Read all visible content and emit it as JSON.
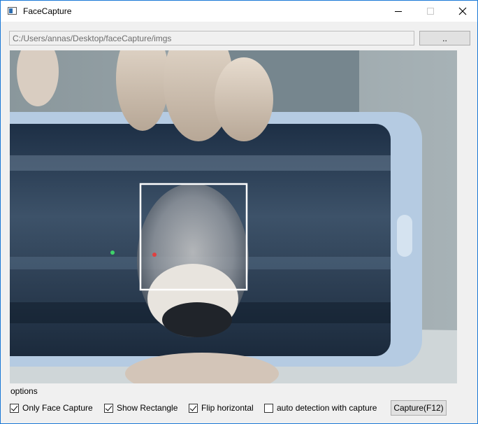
{
  "window": {
    "title": "FaceCapture",
    "accent": "#1a78d6"
  },
  "path": {
    "value": "C:/Users/annas/Desktop/faceCapture/imgs",
    "browse_label": ".."
  },
  "preview": {
    "face_box_color": "#ffffff"
  },
  "options": {
    "label": "options",
    "items": [
      {
        "label": "Only Face Capture",
        "checked": true
      },
      {
        "label": "Show Rectangle",
        "checked": true
      },
      {
        "label": "Flip horizontal",
        "checked": true
      },
      {
        "label": "auto detection with capture",
        "checked": false
      }
    ],
    "capture_label": "Capture(F12)"
  }
}
